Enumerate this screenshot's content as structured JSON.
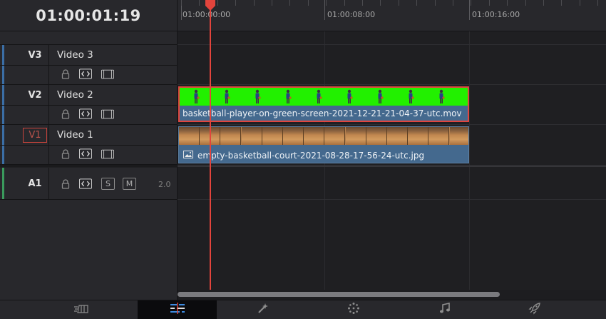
{
  "timecode": "01:00:01:19",
  "ruler": {
    "labels": [
      "01:00:00:00",
      "01:00:08:00",
      "01:00:16:00"
    ]
  },
  "tracks": {
    "v3": {
      "id": "V3",
      "name": "Video 3",
      "color": "#3b6ea5"
    },
    "v2": {
      "id": "V2",
      "name": "Video 2",
      "color": "#3b6ea5"
    },
    "v1": {
      "id": "V1",
      "name": "Video 1",
      "color": "#3b6ea5"
    },
    "a1": {
      "id": "A1",
      "channels": "2.0",
      "solo_label": "S",
      "mute_label": "M",
      "color": "#3a9a5c"
    }
  },
  "clips": {
    "v2": {
      "name": "basketball-player-on-green-screen-2021-12-21-21-04-37-utc.mov",
      "selected": true
    },
    "v1": {
      "name": "empty-basketball-court-2021-08-28-17-56-24-utc.jpg",
      "selected": false
    }
  },
  "pages": [
    {
      "name": "cut",
      "icon": "cut-page-icon"
    },
    {
      "name": "edit",
      "icon": "edit-page-icon",
      "active": true
    },
    {
      "name": "fusion",
      "icon": "fusion-page-icon"
    },
    {
      "name": "color",
      "icon": "color-page-icon"
    },
    {
      "name": "fairlight",
      "icon": "fairlight-page-icon"
    },
    {
      "name": "deliver",
      "icon": "deliver-page-icon"
    }
  ],
  "colors": {
    "accent_red": "#e2443c",
    "clip_blue": "#44698e",
    "green_screen": "#22f000"
  }
}
